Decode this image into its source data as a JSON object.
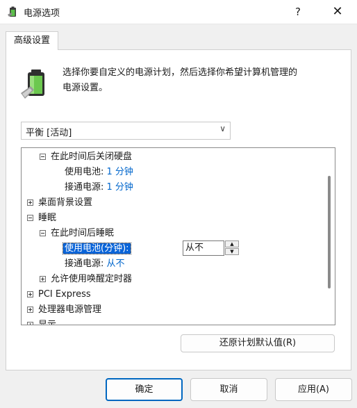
{
  "window": {
    "title": "电源选项",
    "help": "?",
    "close": "✕"
  },
  "tab": {
    "label": "高级设置"
  },
  "description": "选择你要自定义的电源计划，然后选择你希望计算机管理的\n电源设置。",
  "plan_select": {
    "value": "平衡 [活动]"
  },
  "tree": {
    "harddisk_group": "在此时间后关闭硬盘",
    "harddisk_battery_label": "使用电池:",
    "harddisk_battery_value": "1 分钟",
    "harddisk_ac_label": "接通电源:",
    "harddisk_ac_value": "1 分钟",
    "desktop_bg": "桌面背景设置",
    "sleep": "睡眠",
    "sleep_after": "在此时间后睡眠",
    "sleep_battery_label": "使用电池(分钟):",
    "sleep_battery_value": "从不",
    "sleep_ac_label": "接通电源:",
    "sleep_ac_value": "从不",
    "wake_timers": "允许使用唤醒定时器",
    "pci_express": "PCI Express",
    "processor": "处理器电源管理",
    "display": "显示"
  },
  "restore_button": "还原计划默认值(R)",
  "buttons": {
    "ok": "确定",
    "cancel": "取消",
    "apply": "应用(A)"
  },
  "colors": {
    "accent": "#0067c0",
    "link": "#0066cc",
    "selection": "#0a64d8"
  }
}
